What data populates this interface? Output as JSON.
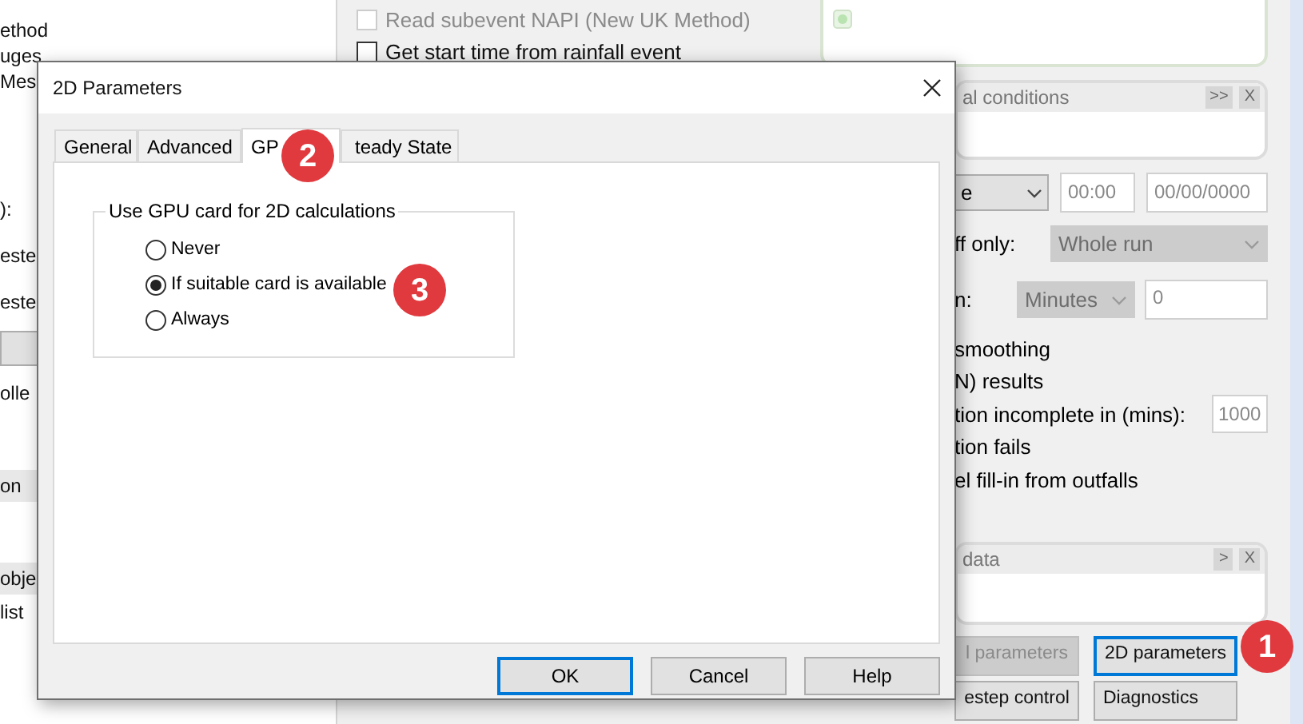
{
  "background": {
    "left_items": [
      {
        "kind": "text",
        "text": "ethod"
      },
      {
        "kind": "text",
        "text": "uges"
      },
      {
        "kind": "text",
        "text": "Mes"
      },
      {
        "kind": "text",
        "text": "):"
      },
      {
        "kind": "text",
        "text": "este"
      },
      {
        "kind": "text",
        "text": "este"
      },
      {
        "kind": "dropdown"
      },
      {
        "kind": "text",
        "text": "olle"
      },
      {
        "kind": "band",
        "text": "on"
      },
      {
        "kind": "band",
        "text": "obje"
      },
      {
        "kind": "text",
        "text": "list"
      }
    ],
    "checkboxes": [
      {
        "label": "Read subevent NAPI (New UK Method)",
        "checked": false,
        "disabled": true
      },
      {
        "label": "Get start time from rainfall event",
        "checked": false,
        "disabled": false
      }
    ],
    "conditions_panel": {
      "title": "al conditions",
      "buttons": [
        ">>",
        "X"
      ]
    },
    "start_row": {
      "dropdown": "e",
      "time": "00:00",
      "date": "00/00/0000"
    },
    "cutoff_row": {
      "label": "ff only:",
      "dropdown": "Whole run",
      "disabled": true
    },
    "interval_row": {
      "label": "n:",
      "dropdown": "Minutes",
      "disabled": true,
      "value": "0"
    },
    "options": [
      {
        "label": "smoothing"
      },
      {
        "label": "N) results"
      },
      {
        "label": "tion incomplete in (mins):",
        "value": "1000"
      },
      {
        "label": "tion fails"
      },
      {
        "label": "el fill-in from outfalls"
      }
    ],
    "data_panel": {
      "title": "data",
      "buttons": [
        ">",
        "X"
      ]
    },
    "buttons": [
      {
        "label": "l parameters",
        "disabled": true,
        "focused": false
      },
      {
        "label": "2D parameters",
        "disabled": false,
        "focused": true
      },
      {
        "label": "estep control",
        "disabled": false,
        "focused": false
      },
      {
        "label": "Diagnostics",
        "disabled": false,
        "focused": false
      }
    ]
  },
  "dialog": {
    "title": "2D Parameters",
    "tabs": [
      {
        "label": "General",
        "selected": false
      },
      {
        "label": "Advanced",
        "selected": false
      },
      {
        "label": "GP",
        "selected": true
      },
      {
        "label": "teady State",
        "selected": false
      }
    ],
    "group": {
      "legend": "Use GPU card for 2D calculations",
      "options": [
        {
          "label": "Never",
          "selected": false
        },
        {
          "label": "If suitable card is available",
          "selected": true
        },
        {
          "label": "Always",
          "selected": false
        }
      ]
    },
    "buttons": [
      {
        "label": "OK",
        "default": true
      },
      {
        "label": "Cancel",
        "default": false
      },
      {
        "label": "Help",
        "default": false
      }
    ]
  },
  "badges": [
    "1",
    "2",
    "3"
  ]
}
